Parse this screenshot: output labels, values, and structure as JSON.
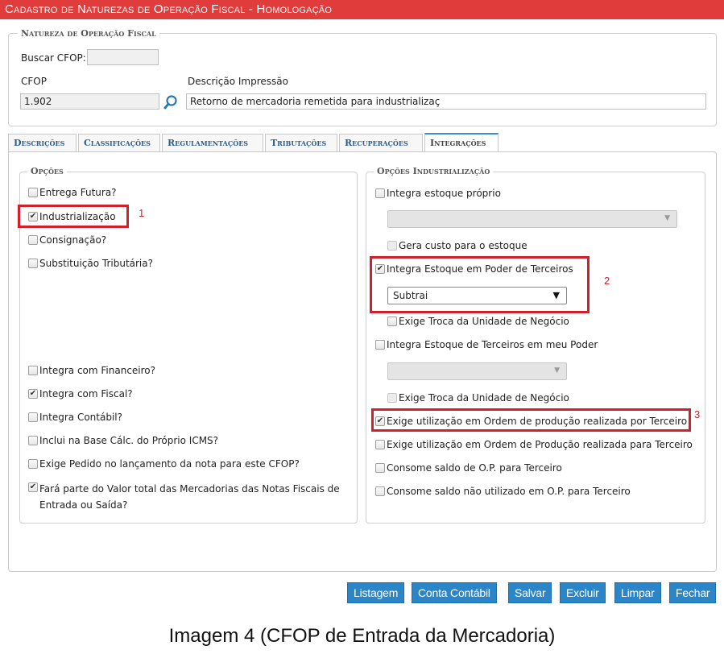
{
  "window": {
    "title": "Cadastro de Naturezas de Operação Fiscal  - Homologação"
  },
  "natureza": {
    "legend": "Natureza de Operação Fiscal",
    "buscar_label": "Buscar CFOP:",
    "buscar_value": "",
    "cfop_label": "CFOP",
    "cfop_value": "1.902",
    "descricao_label": "Descrição Impressão",
    "descricao_value": "Retorno de mercadoria remetida para industrializaç"
  },
  "tabs": [
    {
      "label": "Descrições"
    },
    {
      "label": "Classificações"
    },
    {
      "label": "Regulamentações"
    },
    {
      "label": "Tributações"
    },
    {
      "label": "Recuperações"
    },
    {
      "label": "Integrações",
      "active": true
    }
  ],
  "opcoes": {
    "legend": "Opções",
    "items": [
      {
        "label": "Entrega Futura?",
        "checked": false
      },
      {
        "label": "Industrialização",
        "checked": true
      },
      {
        "label": "Consignação?",
        "checked": false
      },
      {
        "label": "Substituição Tributária?",
        "checked": false
      },
      {
        "label": "Integra com Financeiro?",
        "checked": false
      },
      {
        "label": "Integra com Fiscal?",
        "checked": true
      },
      {
        "label": "Integra Contábil?",
        "checked": false
      },
      {
        "label": "Inclui na Base Cálc. do Próprio ICMS?",
        "checked": false
      },
      {
        "label": "Exige Pedido no lançamento da nota para este CFOP?",
        "checked": false
      },
      {
        "label": "Fará parte do Valor total das Mercadorias das Notas Fiscais de Entrada ou Saída?",
        "checked": true
      }
    ]
  },
  "industrializacao": {
    "legend": "Opções Industrialização",
    "integra_estoque_proprio": "Integra estoque próprio",
    "gera_custo": "Gera custo para o estoque",
    "integra_poder_terceiros": "Integra Estoque em Poder de Terceiros",
    "select_value": "Subtrai",
    "exige_troca_1": "Exige Troca da Unidade de Negócio",
    "integra_terceiros_meu_poder": "Integra Estoque de Terceiros em meu Poder",
    "exige_troca_2": "Exige Troca da Unidade de Negócio",
    "exige_ordem_por_terceiro": "Exige utilização em Ordem de produção realizada por Terceiro",
    "exige_ordem_para_terceiro": "Exige utilização em Ordem de Produção realizada para Terceiro",
    "consome_saldo": "Consome saldo de O.P. para Terceiro",
    "consome_saldo_nao_utilizado": "Consome saldo não utilizado em O.P. para Terceiro"
  },
  "annotations": {
    "n1": "1",
    "n2": "2",
    "n3": "3"
  },
  "buttons": {
    "listagem": "Listagem",
    "conta_contabil": "Conta Contábil",
    "salvar": "Salvar",
    "excluir": "Excluir",
    "limpar": "Limpar",
    "fechar": "Fechar"
  },
  "caption": "Imagem 4 (CFOP de Entrada da Mercadoria)",
  "colors": {
    "titlebar": "#e03c3c",
    "button": "#2b86c9",
    "highlight": "#d1202b"
  }
}
